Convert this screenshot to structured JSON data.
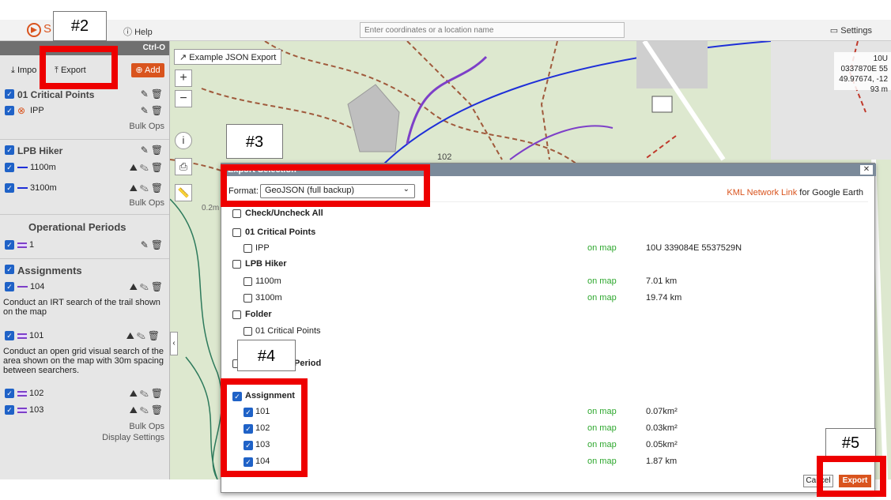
{
  "topbar": {
    "logo_letter": "S",
    "help": "Help",
    "search_placeholder": "Enter coordinates or a location name",
    "settings": "Settings"
  },
  "sidebar": {
    "shortcut": "Ctrl-O",
    "import": "Impo",
    "export": "Export",
    "add": "Add",
    "critical_points": "01 Critical Points",
    "ipp": "IPP",
    "bulk_ops": "Bulk Ops",
    "lpb_hiker": "LPB Hiker",
    "hiker_1100": "1100m",
    "hiker_3100": "3100m",
    "operational_periods": "Operational Periods",
    "op_period_1": "1",
    "assignments": "Assignments",
    "a104": "104",
    "a104_desc": "Conduct an IRT search of the trail shown on the map",
    "a101": "101",
    "a101_desc": "Conduct an open grid visual search of the area shown on the map with 30m spacing between searchers.",
    "a102": "102",
    "a103": "103",
    "display_settings": "Display Settings"
  },
  "map": {
    "json_export": "Example JSON Export",
    "coord_1": "10U 0337870E 55",
    "coord_2": "49.97674, -12",
    "coord_3": "93 m",
    "label_102": "102",
    "label_02mi": "0.2m"
  },
  "dialog": {
    "title": "Export Selection",
    "format_label": "Format:",
    "format_value": "GeoJSON (full backup)",
    "kml_link": "KML Network Link",
    "kml_suffix": " for Google Earth",
    "check_all": "Check/Uncheck All",
    "on_map": "on map",
    "rows": {
      "critical_points": "01 Critical Points",
      "ipp": "IPP",
      "ipp_val": "10U 339084E 5537529N",
      "lpb_hiker": "LPB Hiker",
      "h1100": "1100m",
      "h1100_val": "7.01 km",
      "h3100": "3100m",
      "h3100_val": "19.74 km",
      "folder": "Folder",
      "folder_cp": "01 Critical Points",
      "op_period": "Period",
      "assignment": "Assignment",
      "a101": "101",
      "a101_val": "0.07km²",
      "a102": "102",
      "a102_val": "0.03km²",
      "a103": "103",
      "a103_val": "0.05km²",
      "a104": "104",
      "a104_val": "1.87 km"
    },
    "cancel": "Cancel",
    "export": "Export"
  },
  "callouts": {
    "c2": "#2",
    "c3": "#3",
    "c4": "#4",
    "c5": "#5"
  },
  "colors": {
    "accent": "#d9541e",
    "checkbox": "#1f62c7",
    "on_map": "#2fa82f",
    "highlight": "#ee0000"
  }
}
